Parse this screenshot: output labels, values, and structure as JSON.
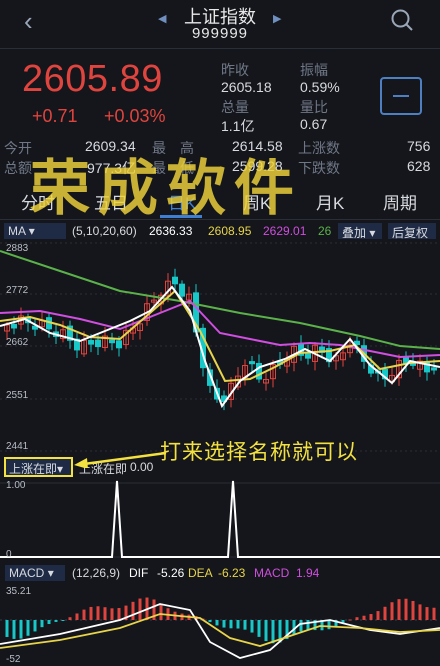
{
  "header": {
    "back_icon": "chevron-left-icon",
    "title": "上证指数",
    "code": "999999",
    "search_icon": "search-icon"
  },
  "quote": {
    "price": "2605.89",
    "change": "+0.71",
    "change_pct": "+0.03%",
    "prev_close_label": "昨收",
    "prev_close": "2605.18",
    "amplitude_label": "振幅",
    "amplitude": "0.59%",
    "volume_label": "总量",
    "volume": "1.1亿",
    "vol_ratio_label": "量比",
    "vol_ratio": "0.67",
    "open_label": "今开",
    "open": "2609.34",
    "high_label": "最　高",
    "high": "2614.58",
    "up_count_label": "上涨数",
    "up_count": "756",
    "amount_label": "总额",
    "amount": "977.3亿",
    "low_label": "最　低",
    "low": "2599.28",
    "down_count_label": "下跌数",
    "down_count": "628"
  },
  "tabs": [
    "分时",
    "五日",
    "日K",
    "周K",
    "月K",
    "周期"
  ],
  "active_tab": "日K",
  "ma_bar": {
    "indicator": "MA",
    "params": "(5,10,20,60)",
    "values": [
      "2636.33",
      "2608.95",
      "2629.01",
      "26"
    ],
    "overlay": "叠加",
    "adjust": "后复权"
  },
  "price_axis": [
    "2883",
    "2772",
    "2662",
    "2551",
    "2441"
  ],
  "vol_bar": {
    "indicator": "上涨在即",
    "label": "上涨在即",
    "value": "0.00"
  },
  "vol_axis": [
    "1.00",
    "0"
  ],
  "macd_bar": {
    "indicator": "MACD",
    "params": "(12,26,9)",
    "dif_label": "DIF",
    "dif": "-5.26",
    "dea_label": "DEA",
    "dea": "-6.23",
    "macd_label": "MACD",
    "macd": "1.94"
  },
  "macd_axis": [
    "35.21",
    "-52"
  ],
  "watermark": "荣成软件",
  "annotation": "打来选择名称就可以",
  "colors": {
    "up": "#e0443e",
    "down": "#18c7c7",
    "ma5": "#ffffff",
    "ma10": "#e8d44a",
    "ma20": "#d04ee0",
    "ma60": "#5bb24a",
    "accent": "#3f7fd3"
  }
}
